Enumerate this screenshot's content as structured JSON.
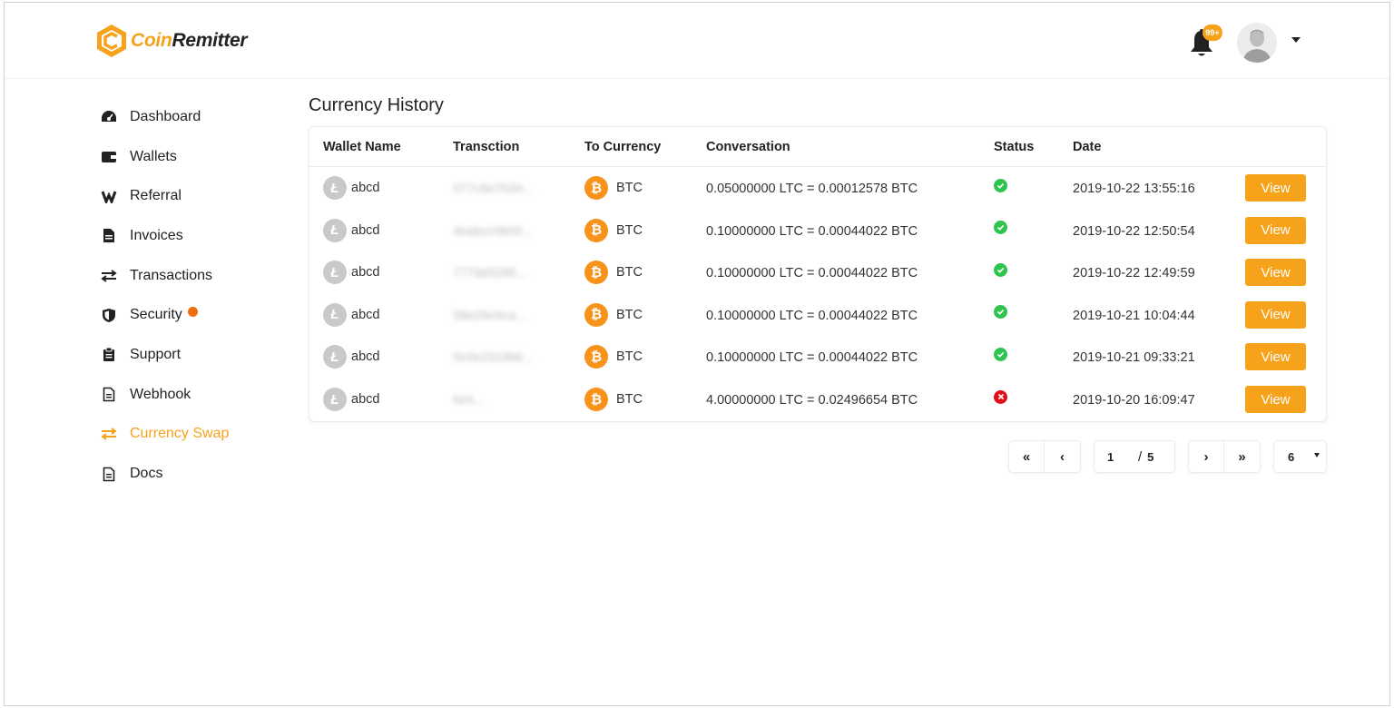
{
  "brand": {
    "name_part1": "Coin",
    "name_part2": "Remitter"
  },
  "header": {
    "notification_count": "99+"
  },
  "sidebar": {
    "items": [
      {
        "label": "Dashboard",
        "icon": "dashboard-icon"
      },
      {
        "label": "Wallets",
        "icon": "wallet-icon"
      },
      {
        "label": "Referral",
        "icon": "referral-icon"
      },
      {
        "label": "Invoices",
        "icon": "invoice-icon"
      },
      {
        "label": "Transactions",
        "icon": "transactions-icon"
      },
      {
        "label": "Security",
        "icon": "shield-icon"
      },
      {
        "label": "Support",
        "icon": "clipboard-icon"
      },
      {
        "label": "Webhook",
        "icon": "document-icon"
      },
      {
        "label": "Currency Swap",
        "icon": "swap-icon"
      },
      {
        "label": "Docs",
        "icon": "document-icon"
      }
    ],
    "active": "Currency Swap"
  },
  "main": {
    "title": "Currency History",
    "columns": [
      "Wallet Name",
      "Transction",
      "To Currency",
      "Conversation",
      "Status",
      "Date"
    ],
    "rows": [
      {
        "wallet": "abcd",
        "tx": "077c8e7b34...",
        "to": "BTC",
        "conversion": "0.05000000 LTC = 0.00012578 BTC",
        "status": "success",
        "date": "2019-10-22 13:55:16",
        "action": "View"
      },
      {
        "wallet": "abcd",
        "tx": "4eabcc0b00...",
        "to": "BTC",
        "conversion": "0.10000000 LTC = 0.00044022 BTC",
        "status": "success",
        "date": "2019-10-22 12:50:54",
        "action": "View"
      },
      {
        "wallet": "abcd",
        "tx": "7779d3285...",
        "to": "BTC",
        "conversion": "0.10000000 LTC = 0.00044022 BTC",
        "status": "success",
        "date": "2019-10-22 12:49:59",
        "action": "View"
      },
      {
        "wallet": "abcd",
        "tx": "58e26e9ca...",
        "to": "BTC",
        "conversion": "0.10000000 LTC = 0.00044022 BTC",
        "status": "success",
        "date": "2019-10-21 10:04:44",
        "action": "View"
      },
      {
        "wallet": "abcd",
        "tx": "0c0e2319b6...",
        "to": "BTC",
        "conversion": "0.10000000 LTC = 0.00044022 BTC",
        "status": "success",
        "date": "2019-10-21 09:33:21",
        "action": "View"
      },
      {
        "wallet": "abcd",
        "tx": "N/A...",
        "to": "BTC",
        "conversion": "4.00000000 LTC = 0.02496654 BTC",
        "status": "failed",
        "date": "2019-10-20 16:09:47",
        "action": "View"
      }
    ]
  },
  "pagination": {
    "first": "«",
    "prev": "‹",
    "current": "1",
    "separator": "/",
    "total": "5",
    "next": "›",
    "last": "»",
    "page_size": "6"
  },
  "colors": {
    "accent": "#f7a21b",
    "btc": "#f7931a",
    "ltc": "#c9c9c9",
    "success": "#2ec44f",
    "failed": "#e0101a",
    "dot": "#ee6d0c"
  }
}
